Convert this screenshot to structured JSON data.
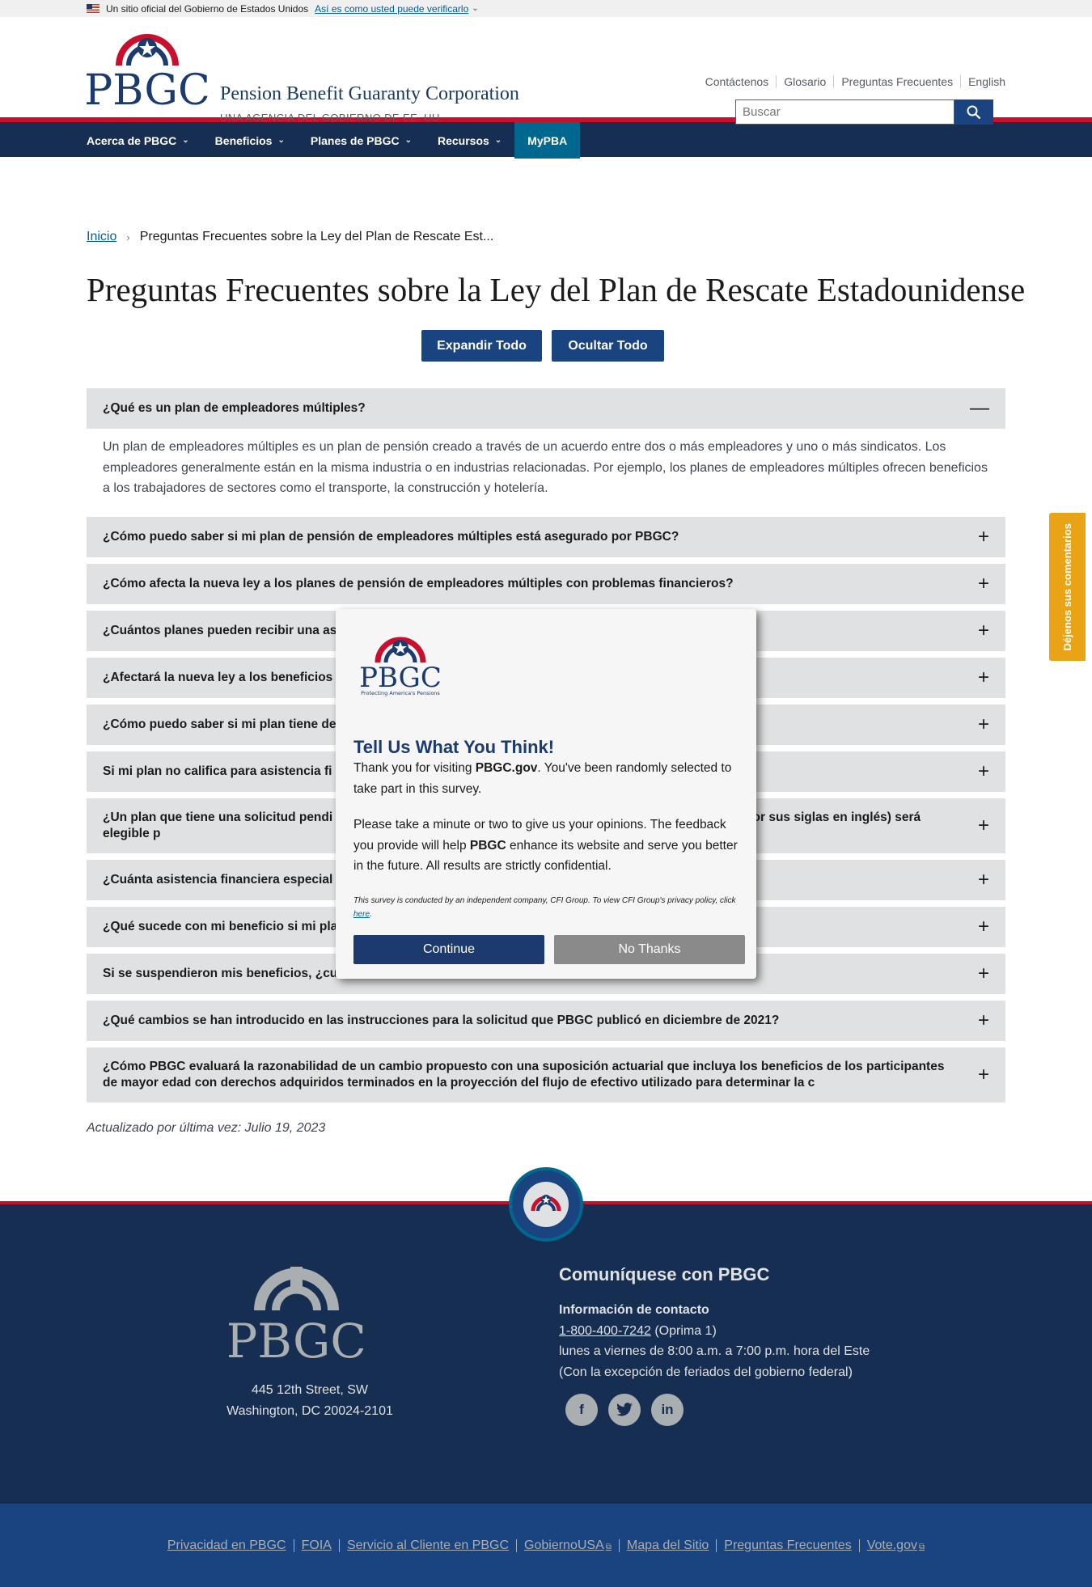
{
  "gov_banner": {
    "text": "Un sitio oficial del Gobierno de Estados Unidos",
    "link": "Así es como usted puede verificarlo"
  },
  "header": {
    "logo_text": "PBGC",
    "org_name": "Pension Benefit Guaranty Corporation",
    "org_sub": "UNA AGENCIA DEL GOBIERNO DE EE. UU.",
    "utility_links": [
      "Contáctenos",
      "Glosario",
      "Preguntas Frecuentes",
      "English"
    ],
    "search_placeholder": "Buscar"
  },
  "nav": {
    "items": [
      "Acerca de PBGC",
      "Beneficios",
      "Planes de PBGC",
      "Recursos"
    ],
    "active": "MyPBA"
  },
  "breadcrumb": {
    "home": "Inicio",
    "current": "Preguntas Frecuentes sobre la Ley del Plan de Rescate Est..."
  },
  "page": {
    "title": "Preguntas Frecuentes sobre la Ley del Plan de Rescate Estadounidense",
    "expand_all": "Expandir Todo",
    "collapse_all": "Ocultar Todo",
    "updated": "Actualizado por última vez: Julio 19, 2023"
  },
  "faq": {
    "open_question": "¿Qué es un plan de empleadores múltiples?",
    "open_answer": "Un plan de empleadores múltiples es un plan de pensión creado a través de un acuerdo entre dos o más empleadores y uno o más sindicatos. Los empleadores generalmente están en la misma industria o en industrias relacionadas. Por ejemplo, los planes de empleadores múltiples ofrecen beneficios a los trabajadores de sectores como el transporte, la construcción y hotelería.",
    "questions": [
      "¿Cómo puedo saber si mi plan de pensión de empleadores múltiples está asegurado por PBGC?",
      "¿Cómo afecta la nueva ley a los planes de pensión de empleadores múltiples con problemas financieros?",
      "¿Cuántos planes pueden recibir una as",
      "¿Afectará la nueva ley a los beneficios",
      "¿Cómo puedo saber si mi plan tiene de",
      "Si mi plan no califica para asistencia fi",
      "¿Un plan que tiene una solicitud pendi                                                               dores Múltiples de 2014 (MPRA, por sus siglas en inglés) será elegible p",
      "¿Cuánta asistencia financiera especial",
      "¿Qué sucede con mi beneficio si mi pla",
      "Si se suspendieron mis beneficios, ¿cuándo se r",
      "¿Qué cambios se han introducido en las instrucciones para la solicitud que PBGC publicó en diciembre de 2021?",
      "¿Cómo PBGC evaluará la razonabilidad de un cambio propuesto con una suposición actuarial que incluya los beneficios de los participantes de mayor edad con derechos adquiridos terminados en la proyección del flujo de efectivo utilizado para determinar la c"
    ]
  },
  "feedback_tab": "Déjenos sus comentarios",
  "modal": {
    "logo_tagline": "Protecting America's Pensions",
    "title": "Tell Us What You Think!",
    "p1_a": "Thank you for visiting ",
    "p1_b": "PBGC.gov",
    "p1_c": ". You've been randomly selected to take part in this survey.",
    "p2_a": "Please take a minute or two to give us your opinions. The feedback you provide will help ",
    "p2_b": "PBGC",
    "p2_c": " enhance its website and serve you better in the future. All results are strictly confidential.",
    "fine_a": "This survey is conducted by an independent company, CFI Group. To view CFI Group's privacy policy, click ",
    "fine_link": "here",
    "fine_b": ".",
    "continue": "Continue",
    "no_thanks": "No Thanks"
  },
  "footer": {
    "address_line1": "445 12th Street, SW",
    "address_line2": "Washington, DC 20024-2101",
    "contact_title": "Comuníquese con PBGC",
    "contact_label": "Información de contacto",
    "phone": "1-800-400-7242",
    "phone_note": " (Oprima 1)",
    "hours": "lunes a viernes de 8:00 a.m. a 7:00 p.m. hora del Este",
    "holiday": "(Con la excepción de feriados del gobierno federal)",
    "links": [
      "Privacidad en PBGC",
      "FOIA",
      "Servicio al Cliente en PBGC",
      "GobiernoUSA",
      "Mapa del Sitio",
      "Preguntas Frecuentes",
      "Vote.gov"
    ]
  }
}
